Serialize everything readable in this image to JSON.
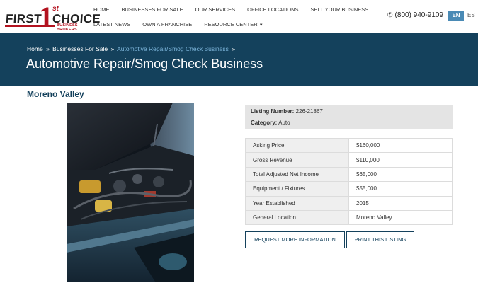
{
  "logo": {
    "word1": "FIRST",
    "number": "1",
    "ordinal": "st",
    "word2": "CHOICE",
    "tagline": "BUSINESS BROKERS"
  },
  "nav": {
    "row1": [
      "HOME",
      "BUSINESSES FOR SALE",
      "OUR SERVICES",
      "OFFICE LOCATIONS",
      "SELL YOUR BUSINESS"
    ],
    "row2": [
      "LATEST NEWS",
      "OWN A FRANCHISE",
      "RESOURCE CENTER"
    ]
  },
  "contact": {
    "phone": "(800) 940-9109",
    "phone_icon": "phone-icon"
  },
  "languages": {
    "active": "EN",
    "other": "ES"
  },
  "colors": {
    "banner": "#14415c",
    "accent": "#b3121f",
    "lang_active": "#4a8ab5",
    "breadcrumb_current": "#7fb8de"
  },
  "breadcrumb": {
    "home": "Home",
    "businesses": "Businesses For Sale",
    "current": "Automotive Repair/Smog Check Business",
    "separator": "»"
  },
  "page_title": "Automotive Repair/Smog Check Business",
  "listing": {
    "location_title": "Moreno Valley",
    "listing_number_label": "Listing Number:",
    "listing_number": "226-21867",
    "category_label": "Category:",
    "category": "Auto",
    "details": [
      {
        "label": "Asking Price",
        "value": "$160,000"
      },
      {
        "label": "Gross Revenue",
        "value": "$110,000"
      },
      {
        "label": "Total Adjusted Net Income",
        "value": "$65,000"
      },
      {
        "label": "Equipment / Fixtures",
        "value": "$55,000"
      },
      {
        "label": "Year Established",
        "value": "2015"
      },
      {
        "label": "General Location",
        "value": "Moreno Valley"
      }
    ]
  },
  "buttons": {
    "request": "REQUEST MORE INFORMATION",
    "print": "PRINT THIS LISTING"
  }
}
